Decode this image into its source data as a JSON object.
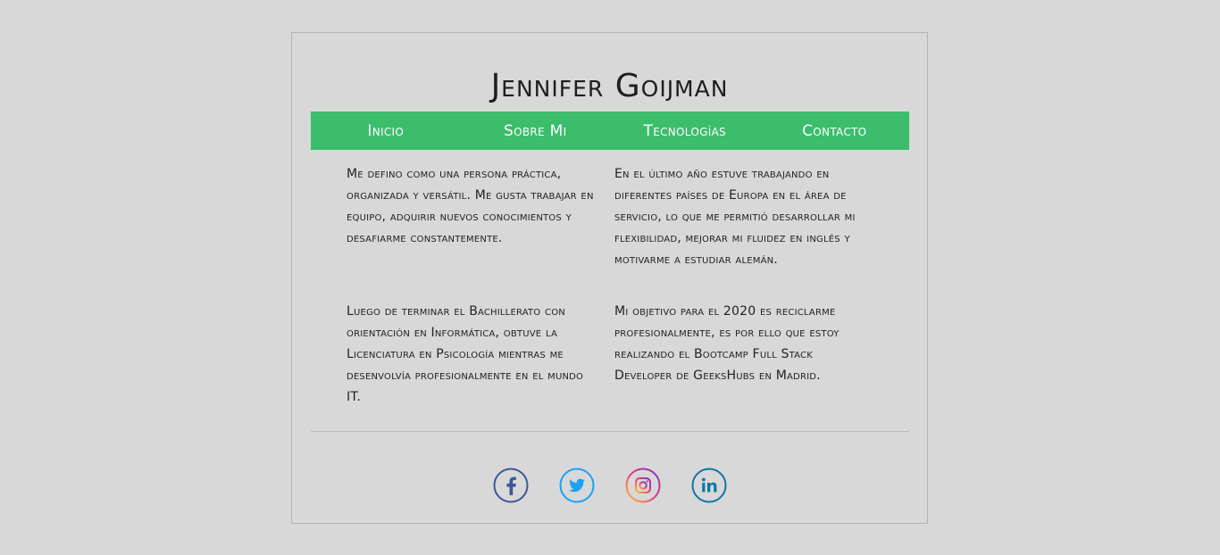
{
  "header": {
    "title": "Jennifer Goijman"
  },
  "nav": {
    "items": [
      {
        "label": "Inicio"
      },
      {
        "label": "Sobre Mi"
      },
      {
        "label": "Tecnologías"
      },
      {
        "label": "Contacto"
      }
    ]
  },
  "about": {
    "p1": "Me defino como una persona práctica, organizada y versátil. Me gusta trabajar en equipo, adquirir nuevos conocimientos y desafiarme constantemente.",
    "p2": "En el último año estuve trabajando en diferentes países de Europa en el área de servicio, lo que me permitió desarrollar mi flexibilidad, mejorar mi fluidez en inglés y motivarme a estudiar alemán.",
    "p3": "Luego de terminar el Bachillerato con orientación en Informática, obtuve la Licenciatura en Psicología mientras me desenvolvía profesionalmente en el mundo IT.",
    "p4": "Mi objetivo para el 2020 es reciclarme profesionalmente, es por ello que estoy realizando el Bootcamp Full Stack Developer de GeeksHubs en Madrid."
  },
  "social": {
    "icons": [
      "facebook-icon",
      "twitter-icon",
      "instagram-icon",
      "linkedin-icon"
    ]
  },
  "colors": {
    "background": "#d8d8d8",
    "nav": "#3bbd6b",
    "facebook": "#3b5998",
    "twitter": "#1da1f2",
    "linkedin": "#0e76a8"
  }
}
